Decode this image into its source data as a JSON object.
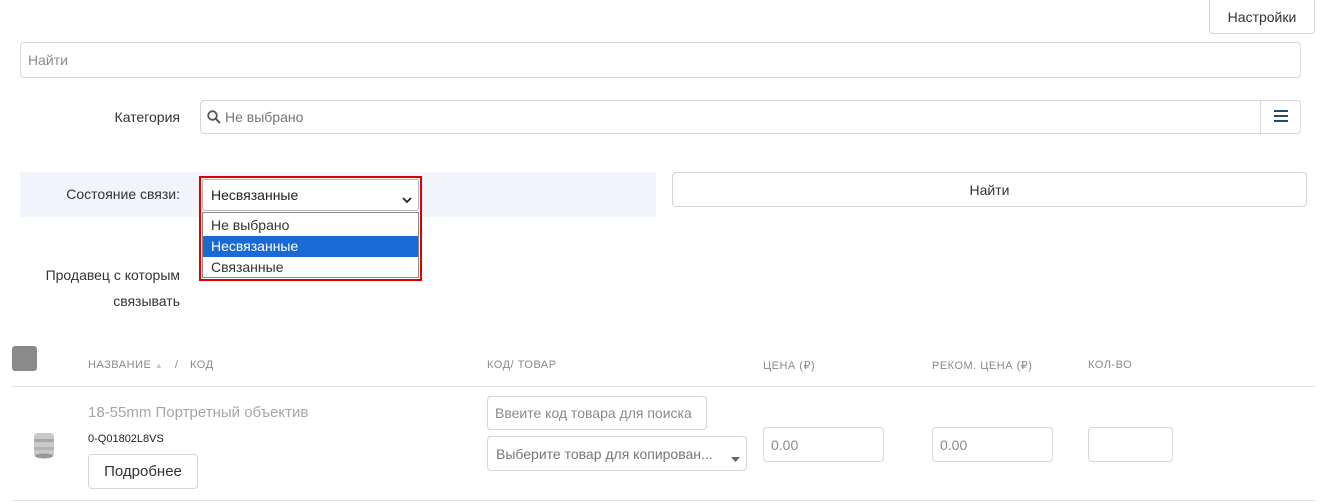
{
  "settings_button": "Настройки",
  "search": {
    "placeholder": "Найти"
  },
  "category": {
    "label": "Категория",
    "placeholder": "Не выбрано"
  },
  "link_state": {
    "label": "Состояние связи:",
    "selected": "Несвязанные",
    "options": [
      "Не выбрано",
      "Несвязанные",
      "Связанные"
    ]
  },
  "find_button": "Найти",
  "seller": {
    "label_line1": "Продавец с которым",
    "label_line2": "связывать"
  },
  "table": {
    "headers": {
      "name": "НАЗВАНИЕ",
      "sort_arrow": "▲",
      "separator": "/",
      "code": "КОД",
      "code_product": "КОД/ ТОВАР",
      "price": "ЦЕНА (₽)",
      "rec_price": "РЕКОМ. ЦЕНА (₽)",
      "qty": "КОЛ-ВО"
    },
    "rows": [
      {
        "title": "18-55mm Портретный объектив",
        "code": "0-Q01802L8VS",
        "details_button": "Подробнее",
        "code_input_placeholder": "Ввеите код товара для поиска",
        "copy_select_placeholder": "Выберите товар для копирован...",
        "price_placeholder": "0.00",
        "rec_price_placeholder": "0.00",
        "qty_value": ""
      }
    ]
  },
  "colors": {
    "accent": "#1a6ad6",
    "highlight_border": "#e00000",
    "highlight_bg": "#f1f5fb"
  }
}
